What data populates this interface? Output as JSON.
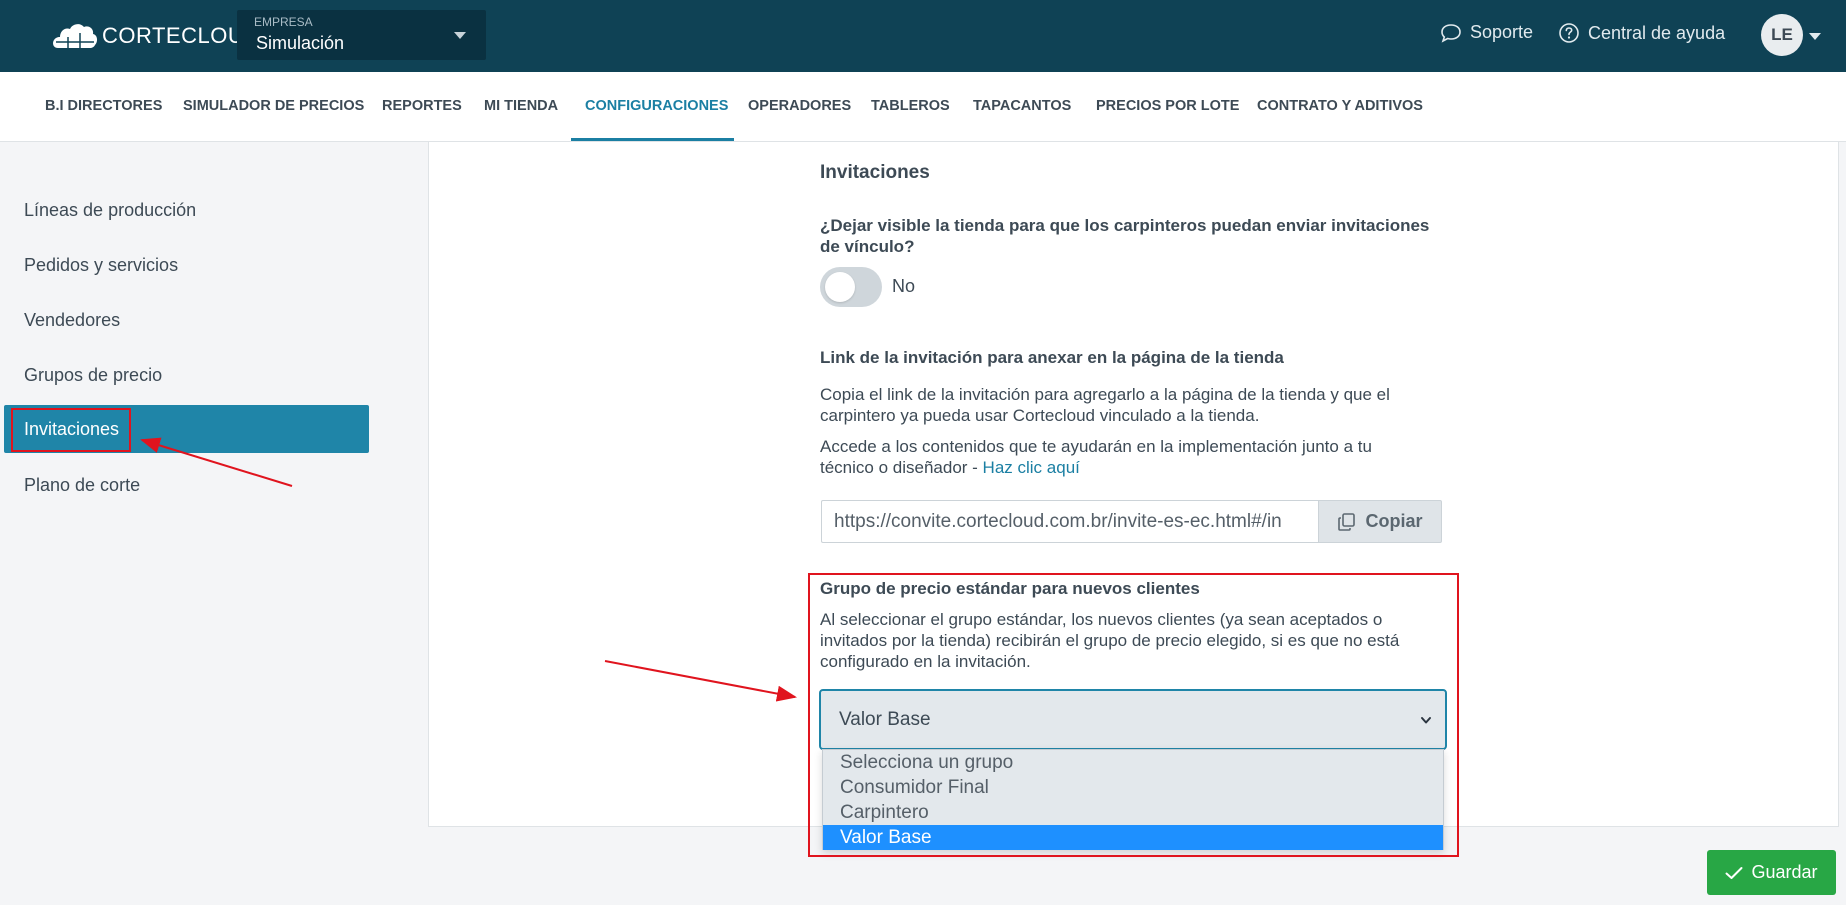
{
  "header": {
    "logo_text": "CORTECLOUD",
    "company_caption": "EMPRESA",
    "company_value": "Simulación",
    "support_label": "Soporte",
    "help_label": "Central de ayuda",
    "user_initials": "LE"
  },
  "nav": {
    "items": [
      {
        "label": "B.I DIRECTORES"
      },
      {
        "label": "SIMULADOR DE PRECIOS"
      },
      {
        "label": "REPORTES"
      },
      {
        "label": "MI TIENDA"
      },
      {
        "label": "CONFIGURACIONES",
        "active": true
      },
      {
        "label": "OPERADORES"
      },
      {
        "label": "TABLEROS"
      },
      {
        "label": "TAPACANTOS"
      },
      {
        "label": "PRECIOS POR LOTE"
      },
      {
        "label": "CONTRATO Y ADITIVOS"
      }
    ]
  },
  "sidebar": {
    "items": [
      {
        "label": "Líneas de producción"
      },
      {
        "label": "Pedidos y servicios"
      },
      {
        "label": "Vendedores"
      },
      {
        "label": "Grupos de precio"
      },
      {
        "label": "Invitaciones",
        "active": true
      },
      {
        "label": "Plano de corte"
      }
    ]
  },
  "main": {
    "section_title": "Invitaciones",
    "visibility_question": "¿Dejar visible la tienda para que los carpinteros puedan enviar invitaciones de vínculo?",
    "toggle_state": "No",
    "link_title": "Link de la invitación para anexar en la página de la tienda",
    "link_desc": "Copia el link de la invitación para agregarlo a la página de la tienda y que el carpintero ya pueda usar Cortecloud vinculado a la tienda.",
    "access_text": "Accede a los contenidos que te ayudarán en la implementación junto a tu técnico o diseñador - ",
    "access_link": "Haz clic aquí",
    "invite_url": "https://convite.cortecloud.com.br/invite-es-ec.html#/in",
    "copy_label": "Copiar",
    "price_group_title": "Grupo de precio estándar para nuevos clientes",
    "price_group_desc": "Al seleccionar el grupo estándar, los nuevos clientes (ya sean aceptados o invitados por la tienda) recibirán el grupo de precio elegido, si es que no está configurado en la invitación.",
    "price_group_selected": "Valor Base",
    "price_group_options": [
      "Selecciona un grupo",
      "Consumidor Final",
      "Carpintero",
      "Valor Base"
    ]
  },
  "footer": {
    "save_label": "Guardar"
  },
  "colors": {
    "header_bg": "#0f4255",
    "accent": "#1f85a8",
    "highlight_red": "#e0141e",
    "save_green": "#28a745",
    "option_selected": "#1e90ff"
  }
}
